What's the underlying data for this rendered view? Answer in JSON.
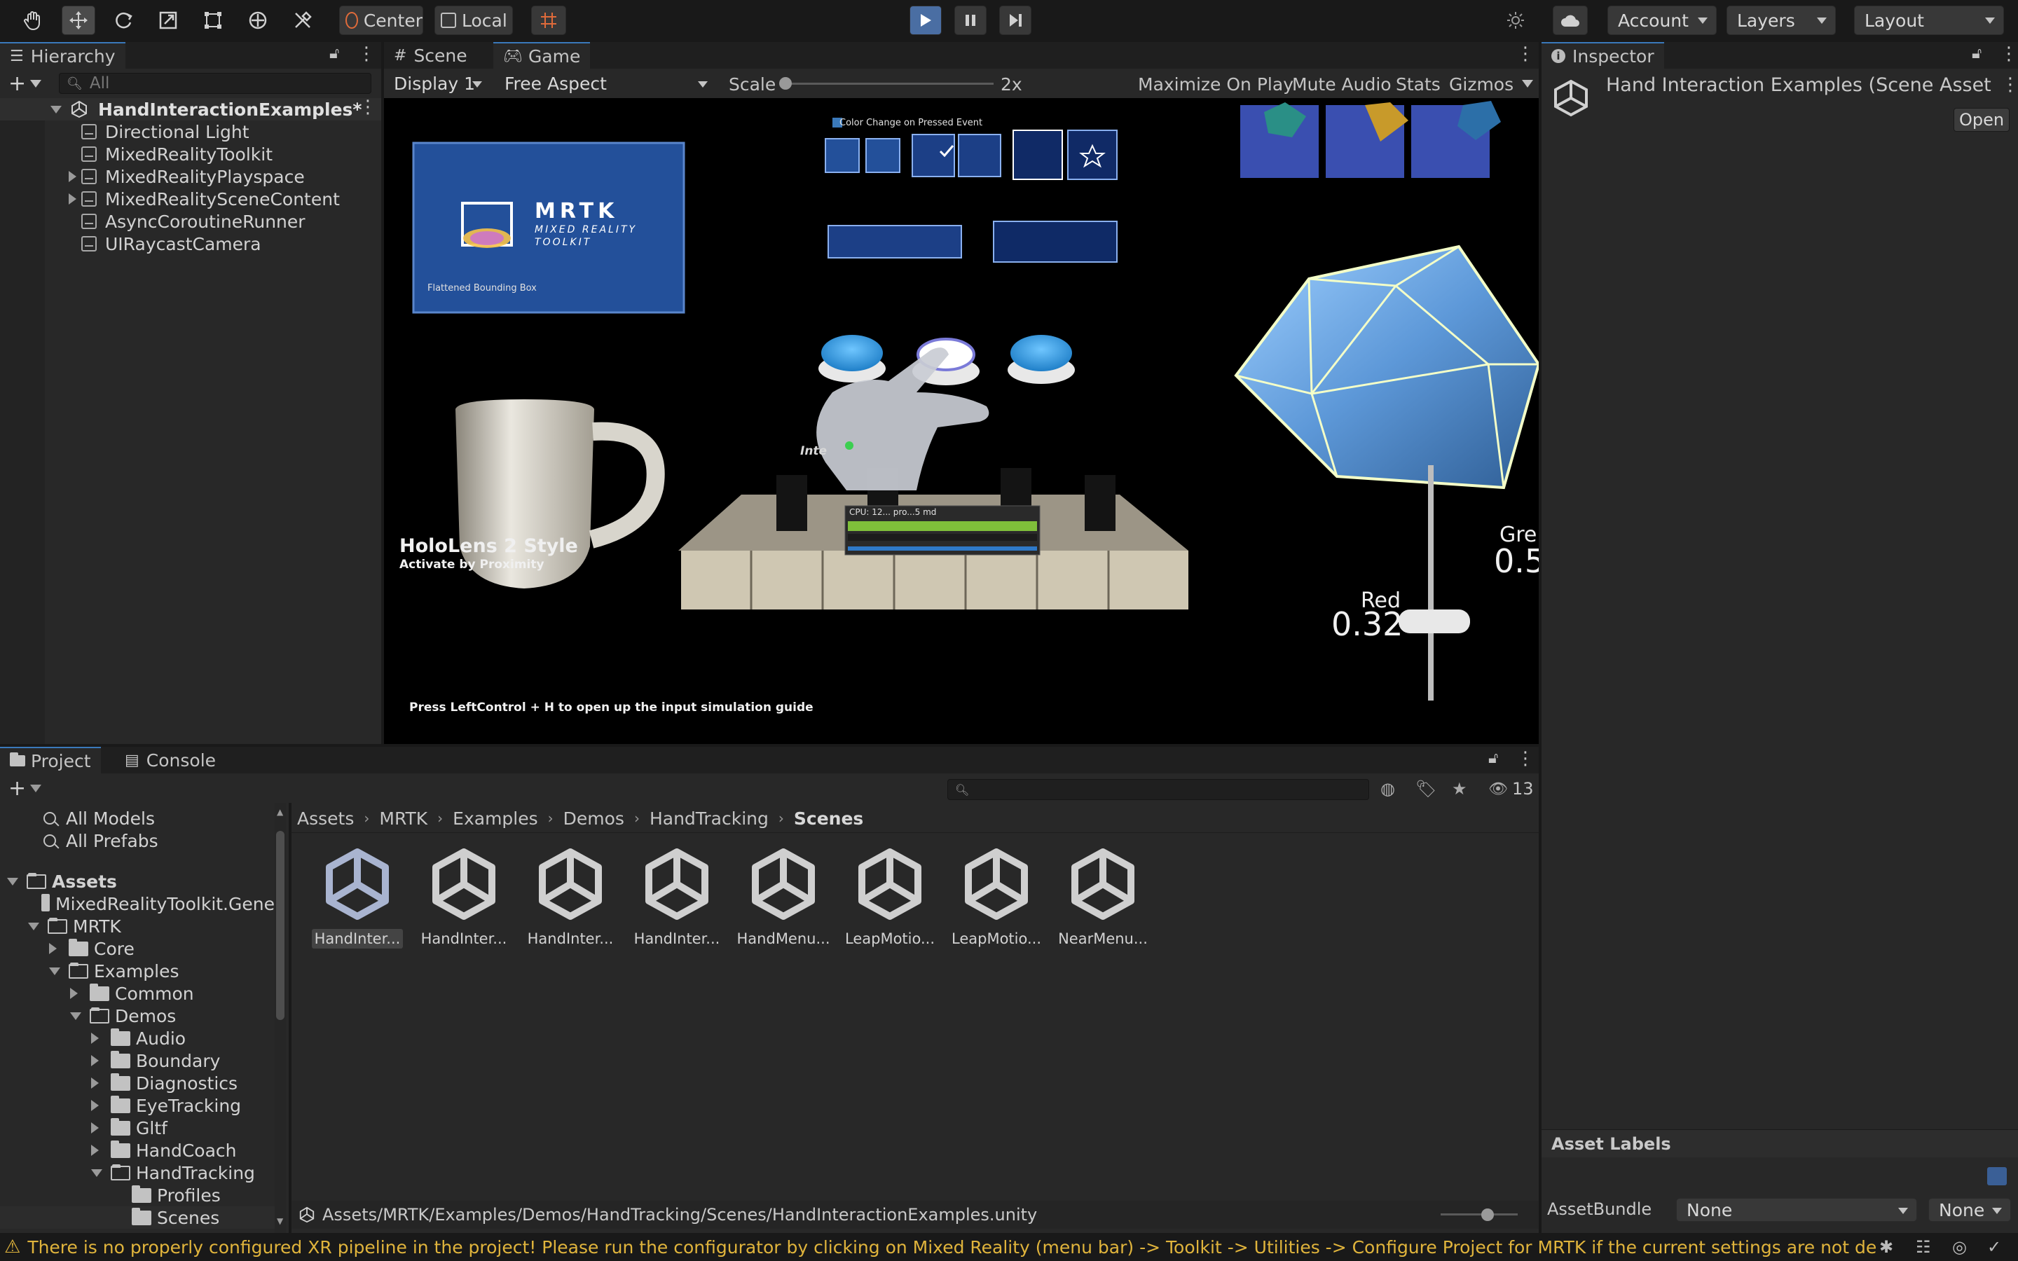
{
  "toolbar": {
    "pivot_label": "Center",
    "space_label": "Local",
    "account_label": "Account",
    "layers_label": "Layers",
    "layout_label": "Layout",
    "tools": [
      "hand-tool-icon",
      "move-tool-icon",
      "rotate-tool-icon",
      "scale-tool-icon",
      "rect-tool-icon",
      "transform-tool-icon",
      "custom-tool-icon"
    ]
  },
  "hierarchy": {
    "tab_label": "Hierarchy",
    "search_placeholder": "All",
    "scene_name": "HandInteractionExamples*",
    "items": [
      {
        "label": "Directional Light",
        "expandable": false
      },
      {
        "label": "MixedRealityToolkit",
        "expandable": false
      },
      {
        "label": "MixedRealityPlayspace",
        "expandable": true
      },
      {
        "label": "MixedRealitySceneContent",
        "expandable": true
      },
      {
        "label": "AsyncCoroutineRunner",
        "expandable": false
      },
      {
        "label": "UIRaycastCamera",
        "expandable": false
      }
    ]
  },
  "game": {
    "tabs": [
      "Scene",
      "Game"
    ],
    "display_label": "Display 1",
    "aspect_label": "Free Aspect",
    "scale_label": "Scale",
    "scale_value": "2x",
    "maximize_label": "Maximize On Play",
    "mute_label": "Mute Audio",
    "stats_label": "Stats",
    "gizmos_label": "Gizmos",
    "scene_text": {
      "color_change": "Color Change on Pressed Event",
      "mrtk_title": "MRTK",
      "mrtk_sub1": "MIXED REALITY",
      "mrtk_sub2": "TOOLKIT",
      "bbox_label": "Flattened Bounding Box",
      "holo_title": "HoloLens 2 Style",
      "holo_sub": "Activate by Proximity",
      "hint": "Press LeftControl + H to open up the input simulation guide",
      "red_label": "Red",
      "red_value": "0.32",
      "green_label": "Gre",
      "green_value": "0.5",
      "inter_label": "Inte",
      "cpu_label": "CPU: 12... pro...5 md"
    }
  },
  "inspector": {
    "tab_label": "Inspector",
    "title": "Hand Interaction Examples (Scene Asset",
    "open_label": "Open",
    "asset_labels": "Asset Labels",
    "assetbundle_label": "AssetBundle",
    "assetbundle_value": "None",
    "variant_value": "None"
  },
  "project": {
    "tabs": [
      "Project",
      "Console"
    ],
    "hidden_count": "13",
    "favorites": [
      "All Models",
      "All Prefabs"
    ],
    "tree": [
      {
        "label": "Assets",
        "depth": 0,
        "state": "open",
        "bold": true
      },
      {
        "label": "MixedRealityToolkit.Gene",
        "depth": 1,
        "state": "none"
      },
      {
        "label": "MRTK",
        "depth": 1,
        "state": "open"
      },
      {
        "label": "Core",
        "depth": 2,
        "state": "closed"
      },
      {
        "label": "Examples",
        "depth": 2,
        "state": "open"
      },
      {
        "label": "Common",
        "depth": 3,
        "state": "closed"
      },
      {
        "label": "Demos",
        "depth": 3,
        "state": "open"
      },
      {
        "label": "Audio",
        "depth": 4,
        "state": "closed"
      },
      {
        "label": "Boundary",
        "depth": 4,
        "state": "closed"
      },
      {
        "label": "Diagnostics",
        "depth": 4,
        "state": "closed"
      },
      {
        "label": "EyeTracking",
        "depth": 4,
        "state": "closed"
      },
      {
        "label": "Gltf",
        "depth": 4,
        "state": "closed"
      },
      {
        "label": "HandCoach",
        "depth": 4,
        "state": "closed"
      },
      {
        "label": "HandTracking",
        "depth": 4,
        "state": "open"
      },
      {
        "label": "Profiles",
        "depth": 5,
        "state": "none"
      },
      {
        "label": "Scenes",
        "depth": 5,
        "state": "none",
        "selected": true
      }
    ],
    "breadcrumb": [
      "Assets",
      "MRTK",
      "Examples",
      "Demos",
      "HandTracking",
      "Scenes"
    ],
    "assets": [
      "HandInter...",
      "HandInter...",
      "HandInter...",
      "HandInter...",
      "HandMenu...",
      "LeapMotio...",
      "LeapMotio...",
      "NearMenu..."
    ],
    "path": "Assets/MRTK/Examples/Demos/HandTracking/Scenes/HandInteractionExamples.unity"
  },
  "status": {
    "message": "There is no properly configured XR pipeline in the project! Please run the configurator by clicking on Mixed Reality (menu bar) -> Toolkit -> Utilities -> Configure Project for MRTK if the current settings are not desired."
  },
  "colors": {
    "accent": "#3a79bb",
    "play_active": "#4a6ea3",
    "warning": "#e0b43c"
  }
}
